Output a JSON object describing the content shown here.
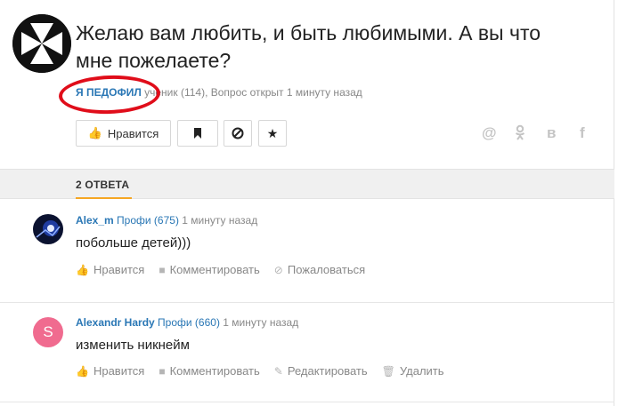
{
  "question": {
    "title": "Желаю вам любить, и быть любимыми. А вы что мне пожелаете?",
    "author": "Я ПЕДОФИЛ",
    "meta_rest": "ученик (114), Вопрос открыт 1 минуту назад",
    "like_label": "Нравится"
  },
  "social": [
    "@",
    "ok",
    "в",
    "f"
  ],
  "tabs": {
    "answers_label": "2 ОТВЕТА"
  },
  "answers": [
    {
      "name": "Alex_m",
      "rank": "Профи (675)",
      "time": "1 минуту назад",
      "text": "побольше детей)))",
      "actions": [
        "Нравится",
        "Комментировать",
        "Пожаловаться"
      ]
    },
    {
      "name": "Alexandr Hardy",
      "rank": "Профи (660)",
      "time": "1 минуту назад",
      "text": "изменить никнейм",
      "avatar_letter": "S",
      "actions": [
        "Нравится",
        "Комментировать",
        "Редактировать",
        "Удалить"
      ]
    }
  ],
  "colors": {
    "link": "#2a77b5",
    "accent": "#f5a623",
    "annotation": "#e00d1a",
    "avatar_s": "#f06b8f"
  }
}
